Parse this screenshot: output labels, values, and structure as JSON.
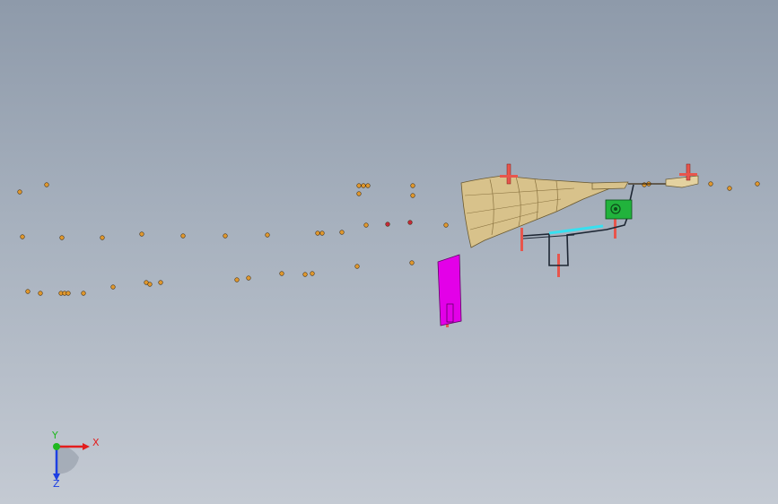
{
  "viewport": {
    "name": "3d-model-view",
    "background_top": "#8e9aaa",
    "background_bottom": "#c4cad3"
  },
  "colors": {
    "point": "#e0982e",
    "point_outline": "#4a3210",
    "red_point": "#c6283a",
    "housing": "#d8c28b",
    "housing_dark": "#8a7340",
    "axis_marker": "#e8554c",
    "bracket": "#e300e8",
    "component": "#21b33c",
    "hose": "#38e0f0",
    "axis_x": "#e31d1d",
    "axis_y": "#1fb81f",
    "axis_z": "#1d3fe3"
  },
  "triad": {
    "x_label": "X",
    "y_label": "Y",
    "z_label": "Z"
  }
}
